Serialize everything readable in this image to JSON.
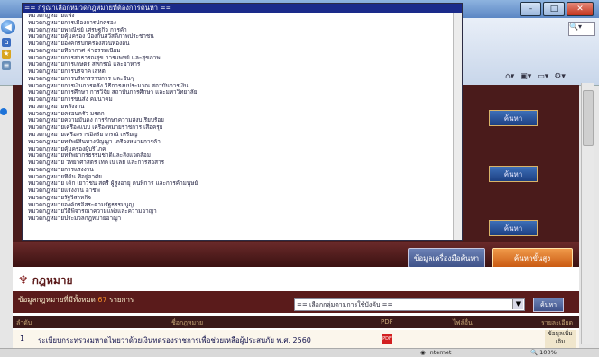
{
  "window": {
    "minimize": "–",
    "maximize": "□",
    "close": "✕"
  },
  "dropdown": {
    "header": "== กรุณาเลือกหมวดกฎหมายที่ต้องการค้นหา ==",
    "items": [
      "หมวดกฎหมายแพ่ง",
      "หมวดกฎหมายการเมืองการปกครอง",
      "หมวดกฎหมายพาณิชย์ เศรษฐกิจ การค้า",
      "หมวดกฎหมายคุ้มครอง ป้องกันสวัสดิภาพประชาชน",
      "หมวดกฎหมายองค์กรปกครองส่วนท้องถิ่น",
      "หมวดกฎหมายที่อากาศ ค่าธรรมเนียม",
      "หมวดกฎหมายการสาธารณสุข การแพทย์ และสุขภาพ",
      "หมวดกฎหมายการเกษตร สหกรณ์ และอาหาร",
      "หมวดกฎหมายการบริจาคโลหิต",
      "หมวดกฎหมายการบริหารราชการ และอื่นๆ",
      "หมวดกฎหมายการเงินการคลัง วิธีการงบประมาณ สถาบันการเงิน",
      "หมวดกฎหมายการศึกษา การวิจัย สถาบันการศึกษา และมหาวิทยาลัย",
      "หมวดกฎหมายการขนส่ง คมนาคม",
      "หมวดกฎหมายพลังงาน",
      "หมวดกฎหมายครอบครัว มรดก",
      "หมวดกฎหมายความมั่นคง การรักษาความสงบเรียบร้อย",
      "หมวดกฎหมายเครื่องแบบ เครื่องหมายราชการ เสื้อครุย",
      "หมวดกฎหมายเครื่องราชอิสริยาภรณ์ เหรียญ",
      "หมวดกฎหมายทรัพย์สินทางปัญญา เครื่องหมายการค้า",
      "หมวดกฎหมายคุ้มครองผู้บริโภค",
      "หมวดกฎหมายทรัพยากรธรรมชาติและสิ่งแวดล้อม",
      "หมวดกฎหมาย วิทยาศาสตร์ เทคโนโลยี และการสื่อสาร",
      "หมวดกฎหมายการแรงงาน",
      "หมวดกฎหมายที่ดิน ที่อยู่อาศัย",
      "หมวดกฎหมาย เด็ก เยาวชน สตรี ผู้สูงอายุ คนพิการ และการค้ามนุษย์",
      "หมวดกฎหมายแรงงาน อาชีพ",
      "หมวดกฎหมายรัฐวิสาหกิจ",
      "หมวดกฎหมายองค์กรอิสระตามรัฐธรรมนูญ",
      "หมวดกฎหมายวิธีพิจารณาความแพ่งและความอาญา",
      "หมวดกฎหมายประมวลกฎหมายอาญา"
    ]
  },
  "sidebar_buttons": [
    "ค้นหา",
    "ค้นหา",
    "ค้นหา"
  ],
  "actions": {
    "doc_tools": "ข้อมูลเครื่องมือค้นหา",
    "advanced_search": "ค้นหาขั้นสูง"
  },
  "law": {
    "title": "กฎหมาย",
    "summary_prefix": "ข้อมูลกฎหมายที่มีทั้งหมด",
    "summary_count": "67",
    "summary_suffix": "รายการ",
    "type_select": "== เลือกกลุ่มตามการใช้บังคับ ==",
    "go": "ค้นหา",
    "columns": [
      "ลำดับ",
      "ชื่อกฎหมาย",
      "PDF",
      "ไฟล์อื่น",
      "รายละเอียด"
    ],
    "rows": [
      {
        "no": "1",
        "name": "ระเบียบกระทรวงมหาดไทยว่าด้วยเงินทดรองราชการเพื่อช่วยเหลือผู้ประสบภัย พ.ศ. 2560",
        "detail": "ข้อมูลเพิ่มเติม"
      }
    ]
  },
  "status": {
    "zone": "Internet",
    "zoom": "100%"
  },
  "colors": {
    "band": "#4a1b1b",
    "dropdown_header": "#1a2a8a",
    "accent_orange": "#c95a12"
  }
}
